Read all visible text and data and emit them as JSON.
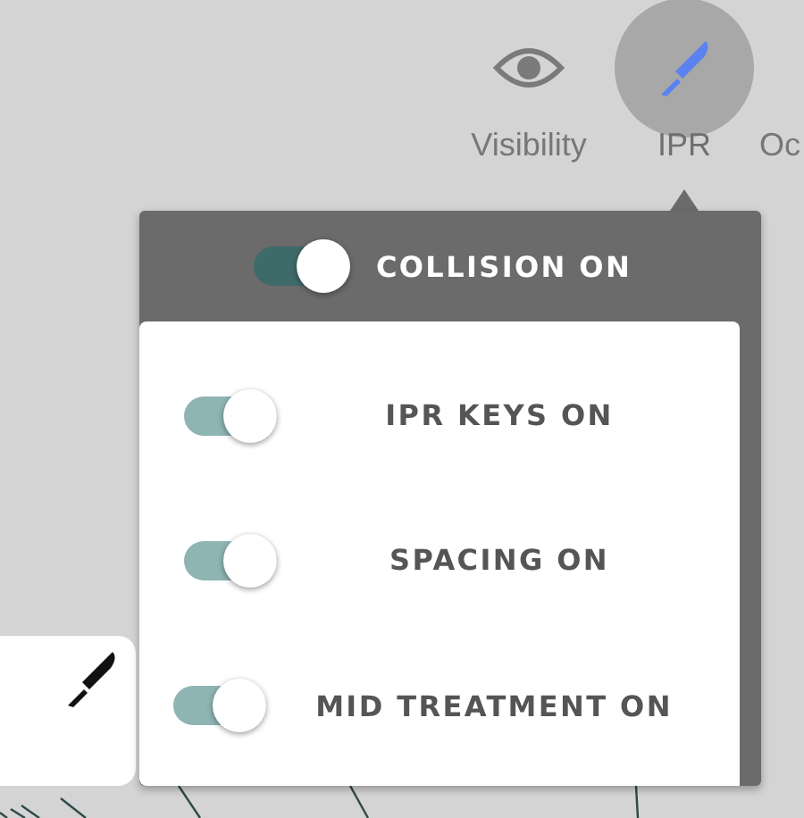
{
  "toolbar": [
    {
      "label": "Visibility",
      "kind": "eye",
      "selected": false
    },
    {
      "label": "IPR",
      "kind": "scalpel",
      "selected": true
    },
    {
      "label": "Oc",
      "kind": "none"
    }
  ],
  "popover": {
    "header": {
      "label": "COLLISION ON",
      "on": true
    },
    "toggles": [
      {
        "label": "IPR KEYS ON",
        "on": true
      },
      {
        "label": "SPACING ON",
        "on": true
      },
      {
        "label": "MID TREATMENT ON",
        "on": true
      }
    ]
  }
}
